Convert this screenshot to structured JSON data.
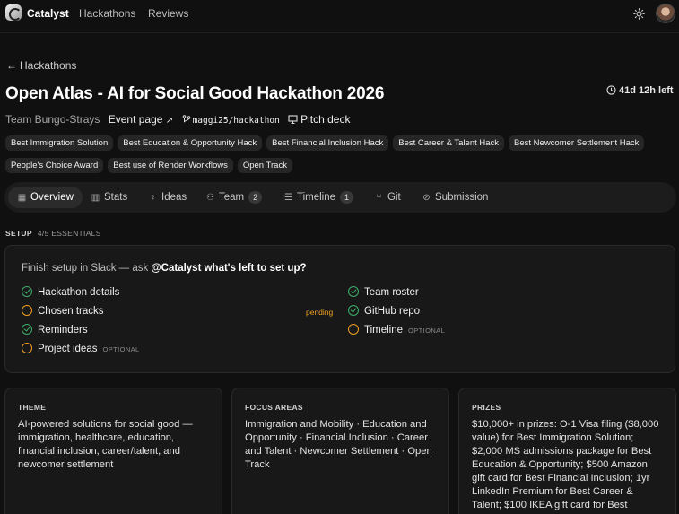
{
  "nav": {
    "brand": "Catalyst",
    "links": [
      "Hackathons",
      "Reviews"
    ]
  },
  "back_label": "Hackathons",
  "title": "Open Atlas - AI for Social Good Hackathon 2026",
  "countdown": "41d 12h left",
  "meta": {
    "team": "Team Bungo-Strays",
    "event_page": "Event page",
    "repo": "maggi25/hackathon",
    "pitch_deck": "Pitch deck"
  },
  "tracks": [
    "Best Immigration Solution",
    "Best Education & Opportunity Hack",
    "Best Financial Inclusion Hack",
    "Best Career & Talent Hack",
    "Best Newcomer Settlement Hack",
    "People's Choice Award",
    "Best use of Render Workflows",
    "Open Track"
  ],
  "tabs": [
    {
      "label": "Overview",
      "icon": "grid-icon"
    },
    {
      "label": "Stats",
      "icon": "bar-chart-icon"
    },
    {
      "label": "Ideas",
      "icon": "lightbulb-icon"
    },
    {
      "label": "Team",
      "icon": "users-icon",
      "count": "2"
    },
    {
      "label": "Timeline",
      "icon": "list-icon",
      "count": "1"
    },
    {
      "label": "Git",
      "icon": "git-branch-icon"
    },
    {
      "label": "Submission",
      "icon": "check-circle-icon"
    }
  ],
  "setup": {
    "heading": "SETUP",
    "progress": "4/5 ESSENTIALS",
    "prompt_prefix": "Finish setup in Slack — ask ",
    "prompt_command": "@Catalyst what's left to set up?",
    "pending_label": "pending",
    "optional_label": "OPTIONAL",
    "items_left": [
      {
        "label": "Hackathon details",
        "done": true
      },
      {
        "label": "Chosen tracks",
        "done": false
      },
      {
        "label": "Reminders",
        "done": true
      },
      {
        "label": "Project ideas",
        "done": false,
        "optional": true
      }
    ],
    "items_right": [
      {
        "label": "Team roster",
        "done": true
      },
      {
        "label": "GitHub repo",
        "done": true
      },
      {
        "label": "Timeline",
        "done": false,
        "optional": true
      }
    ]
  },
  "cards": {
    "theme": {
      "heading": "THEME",
      "body": "AI-powered solutions for social good — immigration, healthcare, education, financial inclusion, career/talent, and newcomer settlement"
    },
    "focus": {
      "heading": "FOCUS AREAS",
      "body": "Immigration and Mobility · Education and Opportunity · Financial Inclusion · Career and Talent · Newcomer Settlement · Open Track"
    },
    "prizes": {
      "heading": "PRIZES",
      "body": "$10,000+ in prizes: O-1 Visa filing ($8,000 value) for Best Immigration Solution; $2,000 MS admissions package for Best Education & Opportunity; $500 Amazon gift card for Best Financial Inclusion; 1yr LinkedIn Premium for Best Career & Talent; $100 IKEA gift card for Best"
    }
  },
  "colors": {
    "background": "#101010",
    "done": "#3fae6a",
    "pending": "#f0a020"
  }
}
